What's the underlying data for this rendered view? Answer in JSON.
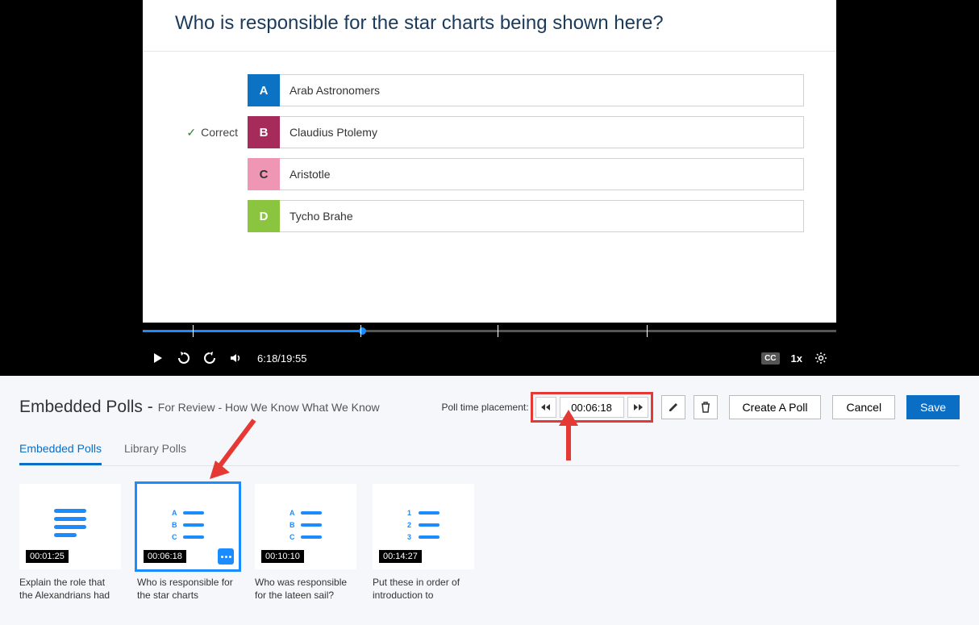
{
  "question": {
    "title": "Who is responsible for the star charts being shown here?",
    "correct_label": "Correct",
    "answers": [
      {
        "letter": "A",
        "text": "Arab Astronomers"
      },
      {
        "letter": "B",
        "text": "Claudius Ptolemy"
      },
      {
        "letter": "C",
        "text": "Aristotle"
      },
      {
        "letter": "D",
        "text": "Tycho Brahe"
      }
    ]
  },
  "player": {
    "time": "6:18/19:55",
    "speed": "1x",
    "cc": "CC"
  },
  "panel": {
    "title": "Embedded Polls -",
    "subtitle": "For Review - How We Know What We Know",
    "placement_label": "Poll time placement:",
    "time_input": "00:06:18",
    "create_label": "Create A Poll",
    "cancel_label": "Cancel",
    "save_label": "Save"
  },
  "tabs": {
    "embedded": "Embedded Polls",
    "library": "Library Polls"
  },
  "cards": [
    {
      "ts": "00:01:25",
      "title": "Explain the role that the Alexandrians had"
    },
    {
      "ts": "00:06:18",
      "title": "Who is responsible for the star charts"
    },
    {
      "ts": "00:10:10",
      "title": "Who was responsible for the lateen sail?"
    },
    {
      "ts": "00:14:27",
      "title": "Put these in order of introduction to"
    }
  ],
  "abc": {
    "a": "A",
    "b": "B",
    "c": "C"
  },
  "num": {
    "n1": "1",
    "n2": "2",
    "n3": "3"
  }
}
